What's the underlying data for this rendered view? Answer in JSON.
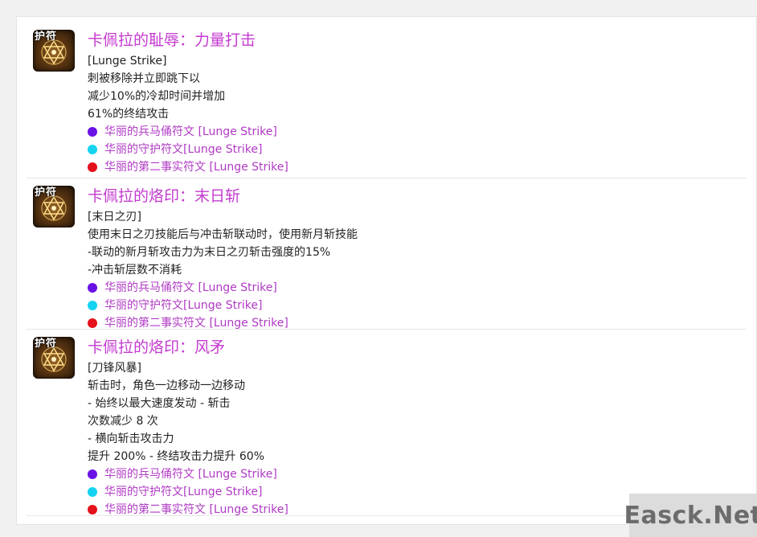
{
  "entries": [
    {
      "icon_label": "护符",
      "title": "卡佩拉的耻辱：力量打击",
      "lines": [
        "[Lunge Strike]",
        "刺被移除并立即跳下以",
        "减少10%的冷却时间并增加",
        "61%的终结攻击"
      ]
    },
    {
      "icon_label": "护符",
      "title": "卡佩拉的烙印：末日斩",
      "lines": [
        "[末日之刃]",
        "使用末日之刃技能后与冲击斩联动时，使用新月斩技能",
        "-联动的新月斩攻击力为末日之刃斩击强度的15%",
        "-冲击斩层数不消耗"
      ]
    },
    {
      "icon_label": "护符",
      "title": "卡佩拉的烙印：风矛",
      "lines": [
        "[刀锋风暴]",
        "斩击时，角色一边移动一边移动",
        "- 始终以最大速度发动 - 斩击",
        "次数减少 8 次",
        "- 横向斩击攻击力",
        "提升 200% - 终结攻击力提升 60%"
      ]
    }
  ],
  "runes": [
    {
      "label": "华丽的兵马俑符文 [Lunge Strike]",
      "color": "#6a12e6"
    },
    {
      "label": "华丽的守护符文[Lunge Strike]",
      "color": "#13d3f0"
    },
    {
      "label": "华丽的第二事实符文 [Lunge Strike]",
      "color": "#e4101a"
    }
  ],
  "colors": {
    "title": "#c43ad0",
    "rune_text": "#b03ac4"
  },
  "icon_name": "amulet-star-icon",
  "watermark": "Easck.Net"
}
